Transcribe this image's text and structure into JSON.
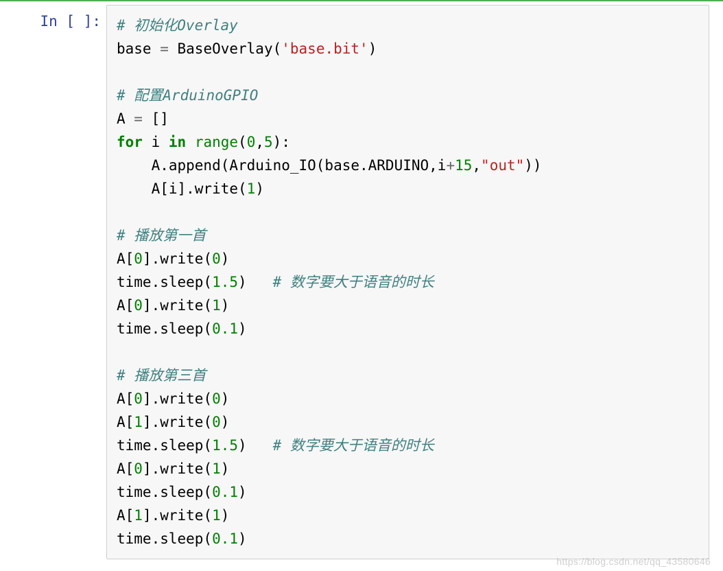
{
  "prompt": "In [ ]:",
  "code_lines": [
    [
      {
        "cls": "c",
        "t": "# 初始化Overlay"
      }
    ],
    [
      {
        "cls": "n",
        "t": "base "
      },
      {
        "cls": "o",
        "t": "="
      },
      {
        "cls": "n",
        "t": " BaseOverlay("
      },
      {
        "cls": "s",
        "t": "'base.bit'"
      },
      {
        "cls": "n",
        "t": ")"
      }
    ],
    [],
    [
      {
        "cls": "c",
        "t": "# 配置ArduinoGPIO"
      }
    ],
    [
      {
        "cls": "n",
        "t": "A "
      },
      {
        "cls": "o",
        "t": "="
      },
      {
        "cls": "n",
        "t": " []"
      }
    ],
    [
      {
        "cls": "k",
        "t": "for"
      },
      {
        "cls": "n",
        "t": " i "
      },
      {
        "cls": "k",
        "t": "in"
      },
      {
        "cls": "n",
        "t": " "
      },
      {
        "cls": "nb",
        "t": "range"
      },
      {
        "cls": "n",
        "t": "("
      },
      {
        "cls": "m",
        "t": "0"
      },
      {
        "cls": "n",
        "t": ","
      },
      {
        "cls": "m",
        "t": "5"
      },
      {
        "cls": "n",
        "t": "):"
      }
    ],
    [
      {
        "cls": "n",
        "t": "    A.append(Arduino_IO(base.ARDUINO,i"
      },
      {
        "cls": "o",
        "t": "+"
      },
      {
        "cls": "m",
        "t": "15"
      },
      {
        "cls": "n",
        "t": ","
      },
      {
        "cls": "s",
        "t": "\"out\""
      },
      {
        "cls": "n",
        "t": "))"
      }
    ],
    [
      {
        "cls": "n",
        "t": "    A[i].write("
      },
      {
        "cls": "m",
        "t": "1"
      },
      {
        "cls": "n",
        "t": ")"
      }
    ],
    [],
    [
      {
        "cls": "c",
        "t": "# 播放第一首"
      }
    ],
    [
      {
        "cls": "n",
        "t": "A["
      },
      {
        "cls": "m",
        "t": "0"
      },
      {
        "cls": "n",
        "t": "].write("
      },
      {
        "cls": "m",
        "t": "0"
      },
      {
        "cls": "n",
        "t": ")"
      }
    ],
    [
      {
        "cls": "n",
        "t": "time.sleep("
      },
      {
        "cls": "m",
        "t": "1.5"
      },
      {
        "cls": "n",
        "t": ")   "
      },
      {
        "cls": "c",
        "t": "# 数字要大于语音的时长"
      }
    ],
    [
      {
        "cls": "n",
        "t": "A["
      },
      {
        "cls": "m",
        "t": "0"
      },
      {
        "cls": "n",
        "t": "].write("
      },
      {
        "cls": "m",
        "t": "1"
      },
      {
        "cls": "n",
        "t": ")"
      }
    ],
    [
      {
        "cls": "n",
        "t": "time.sleep("
      },
      {
        "cls": "m",
        "t": "0.1"
      },
      {
        "cls": "n",
        "t": ")"
      }
    ],
    [],
    [
      {
        "cls": "c",
        "t": "# 播放第三首"
      }
    ],
    [
      {
        "cls": "n",
        "t": "A["
      },
      {
        "cls": "m",
        "t": "0"
      },
      {
        "cls": "n",
        "t": "].write("
      },
      {
        "cls": "m",
        "t": "0"
      },
      {
        "cls": "n",
        "t": ")"
      }
    ],
    [
      {
        "cls": "n",
        "t": "A["
      },
      {
        "cls": "m",
        "t": "1"
      },
      {
        "cls": "n",
        "t": "].write("
      },
      {
        "cls": "m",
        "t": "0"
      },
      {
        "cls": "n",
        "t": ")"
      }
    ],
    [
      {
        "cls": "n",
        "t": "time.sleep("
      },
      {
        "cls": "m",
        "t": "1.5"
      },
      {
        "cls": "n",
        "t": ")   "
      },
      {
        "cls": "c",
        "t": "# 数字要大于语音的时长"
      }
    ],
    [
      {
        "cls": "n",
        "t": "A["
      },
      {
        "cls": "m",
        "t": "0"
      },
      {
        "cls": "n",
        "t": "].write("
      },
      {
        "cls": "m",
        "t": "1"
      },
      {
        "cls": "n",
        "t": ")"
      }
    ],
    [
      {
        "cls": "n",
        "t": "time.sleep("
      },
      {
        "cls": "m",
        "t": "0.1"
      },
      {
        "cls": "n",
        "t": ")"
      }
    ],
    [
      {
        "cls": "n",
        "t": "A["
      },
      {
        "cls": "m",
        "t": "1"
      },
      {
        "cls": "n",
        "t": "].write("
      },
      {
        "cls": "m",
        "t": "1"
      },
      {
        "cls": "n",
        "t": ")"
      }
    ],
    [
      {
        "cls": "n",
        "t": "time.sleep("
      },
      {
        "cls": "m",
        "t": "0.1"
      },
      {
        "cls": "n",
        "t": ")"
      }
    ]
  ],
  "watermark": "https://blog.csdn.net/qq_43580646"
}
